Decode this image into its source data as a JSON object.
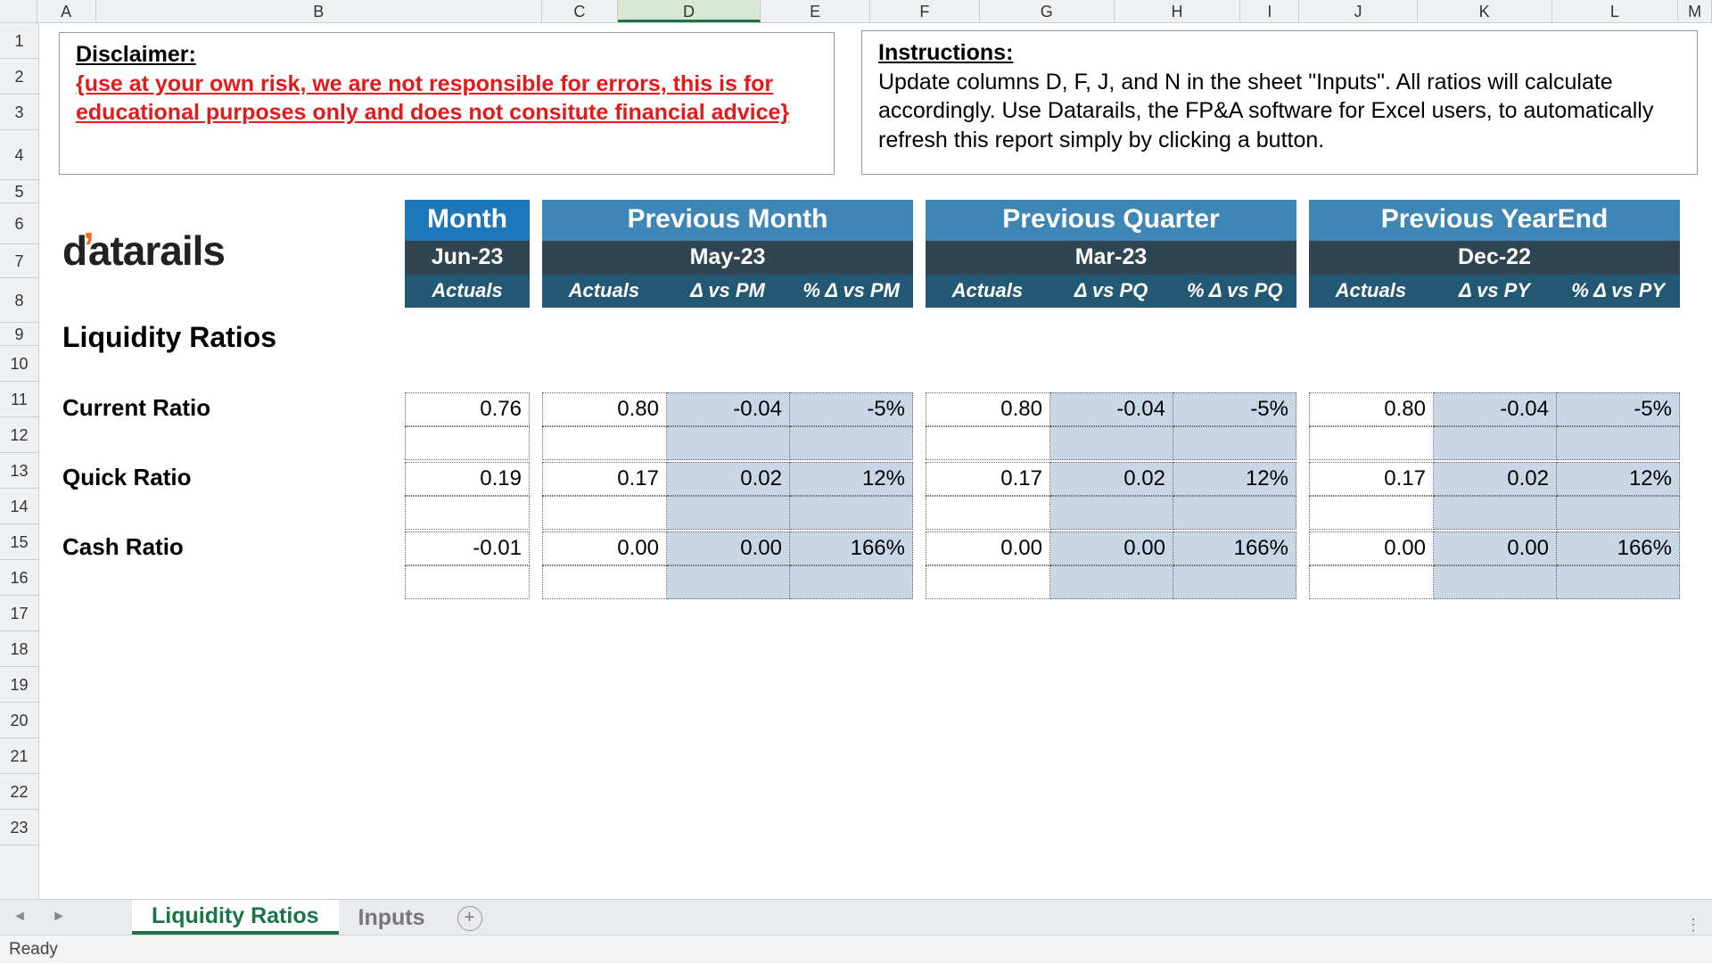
{
  "columns": [
    "A",
    "B",
    "C",
    "D",
    "E",
    "F",
    "G",
    "H",
    "I",
    "J",
    "K",
    "L",
    "M"
  ],
  "selected_col": "D",
  "rows": [
    "1",
    "2",
    "3",
    "4",
    "5",
    "6",
    "7",
    "8",
    "9",
    "10",
    "11",
    "12",
    "13",
    "14",
    "15",
    "16",
    "17",
    "18",
    "19",
    "20",
    "21",
    "22",
    "23"
  ],
  "disclaimer": {
    "heading": "Disclaimer:",
    "text": "{use at your own risk, we are not responsible for errors, this is for educational purposes only and does not consitute financial advice}"
  },
  "instructions": {
    "heading": "Instructions:",
    "text": "Update columns D, F, J, and N in the sheet \"Inputs\". All ratios will calculate accordingly. Use Datarails, the FP&A software for Excel users, to automatically refresh this report simply by clicking a button."
  },
  "logo_text": "datarails",
  "header": {
    "month": {
      "title": "Month",
      "period": "Jun-23",
      "cols": [
        "Actuals"
      ]
    },
    "pm": {
      "title": "Previous Month",
      "period": "May-23",
      "cols": [
        "Actuals",
        "Δ vs PM",
        "% Δ vs PM"
      ]
    },
    "pq": {
      "title": "Previous Quarter",
      "period": "Mar-23",
      "cols": [
        "Actuals",
        "Δ vs PQ",
        "% Δ vs PQ"
      ]
    },
    "py": {
      "title": "Previous YearEnd",
      "period": "Dec-22",
      "cols": [
        "Actuals",
        "Δ vs PY",
        "% Δ vs PY"
      ]
    }
  },
  "section_title": "Liquidity Ratios",
  "ratios": [
    {
      "name": "Current Ratio",
      "m": "0.76",
      "pm": [
        "0.80",
        "-0.04",
        "-5%"
      ],
      "pq": [
        "0.80",
        "-0.04",
        "-5%"
      ],
      "py": [
        "0.80",
        "-0.04",
        "-5%"
      ]
    },
    {
      "name": "Quick Ratio",
      "m": "0.19",
      "pm": [
        "0.17",
        "0.02",
        "12%"
      ],
      "pq": [
        "0.17",
        "0.02",
        "12%"
      ],
      "py": [
        "0.17",
        "0.02",
        "12%"
      ]
    },
    {
      "name": "Cash Ratio",
      "m": "-0.01",
      "pm": [
        "0.00",
        "0.00",
        "166%"
      ],
      "pq": [
        "0.00",
        "0.00",
        "166%"
      ],
      "py": [
        "0.00",
        "0.00",
        "166%"
      ]
    }
  ],
  "tabs": {
    "active": "Liquidity Ratios",
    "other": "Inputs"
  },
  "status": "Ready",
  "colors": {
    "blue": "#1f77bb",
    "dimblue": "#3d86b6",
    "navy": "#235875",
    "dark": "#30454f",
    "shade": "#c9d6e6",
    "green": "#1b7346"
  }
}
